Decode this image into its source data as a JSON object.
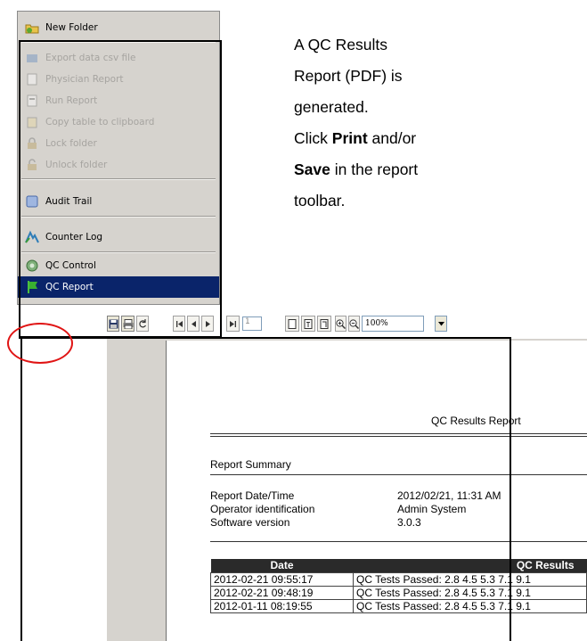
{
  "context_menu": {
    "items": [
      {
        "label": "New Folder",
        "icon": "new-folder-icon"
      },
      {
        "label": "Export data csv file",
        "icon": "export-icon"
      },
      {
        "label": "Physician Report",
        "icon": "physician-report-icon"
      },
      {
        "label": "Run Report",
        "icon": "run-report-icon"
      },
      {
        "label": "Copy table to clipboard",
        "icon": "clipboard-icon"
      },
      {
        "label": "Lock folder",
        "icon": "lock-icon"
      },
      {
        "label": "Unlock folder",
        "icon": "unlock-icon"
      },
      {
        "label": "Audit Trail",
        "icon": "audit-trail-icon"
      },
      {
        "label": "Counter Log",
        "icon": "counter-log-icon"
      },
      {
        "label": "QC Control",
        "icon": "qc-control-icon"
      },
      {
        "label": "QC Report",
        "icon": "qc-report-icon"
      }
    ]
  },
  "instructions": {
    "line1": "A QC Results",
    "line2": "Report (PDF) is",
    "line3": "generated.",
    "line4_pre": "Click ",
    "line4_bold": "Print",
    "line4_post": " and/or",
    "line5_bold": "Save",
    "line5_post": " in the report",
    "line6": "toolbar."
  },
  "toolbar": {
    "page_number": "1",
    "zoom": "100%"
  },
  "report": {
    "title": "QC Results Report",
    "summary_heading": "Report Summary",
    "fields": [
      {
        "label": "Report Date/Time",
        "value": "2012/02/21, 11:31 AM"
      },
      {
        "label": "Operator identification",
        "value": "Admin System"
      },
      {
        "label": "Software version",
        "value": "3.0.3"
      }
    ],
    "table": {
      "headers": [
        "Date",
        "QC Results"
      ],
      "rows": [
        [
          "2012-02-21 09:55:17",
          "QC Tests Passed: 2.8 4.5 5.3 7.1 9.1"
        ],
        [
          "2012-02-21 09:48:19",
          "QC Tests Passed: 2.8 4.5 5.3 7.1 9.1"
        ],
        [
          "2012-01-11 08:19:55",
          "QC Tests Passed: 2.8 4.5 5.3 7.1 9.1"
        ]
      ]
    }
  },
  "colors": {
    "menu_bg": "#d6d3ce",
    "selection": "#0a246a",
    "annotation": "#e01414"
  }
}
